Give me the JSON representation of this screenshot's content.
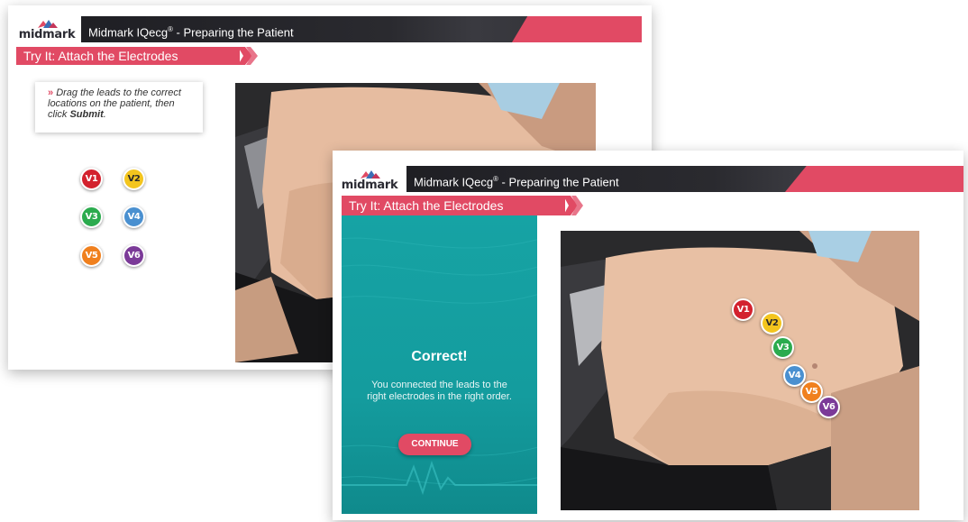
{
  "brand": {
    "name": "midmark"
  },
  "header": {
    "title": "Midmark IQecg",
    "title_sup": "®",
    "subtitle": " -  Preparing the Patient"
  },
  "activity": {
    "title": "Try It: Attach the Electrodes"
  },
  "instruction": {
    "bullet": "»",
    "text_before": "Drag the leads to the correct locations on the patient, then click ",
    "submit": "Submit",
    "text_after": "."
  },
  "feedback": {
    "heading": "Correct!",
    "message": "You connected the leads to the right electrodes in the right order.",
    "continue_label": "CONTINUE"
  },
  "leads": [
    {
      "label": "V1",
      "color": "#d3222e",
      "text_color": "#ffffff"
    },
    {
      "label": "V2",
      "color": "#f3c51e",
      "text_color": "#2a2a2a"
    },
    {
      "label": "V3",
      "color": "#2bab4e",
      "text_color": "#ffffff"
    },
    {
      "label": "V4",
      "color": "#4a90d0",
      "text_color": "#ffffff"
    },
    {
      "label": "V5",
      "color": "#f0801e",
      "text_color": "#ffffff"
    },
    {
      "label": "V6",
      "color": "#7b3a98",
      "text_color": "#ffffff"
    }
  ],
  "colors": {
    "accent": "#e14a64",
    "header_dark": "#26262b",
    "feedback_teal": "#16a3a4"
  }
}
